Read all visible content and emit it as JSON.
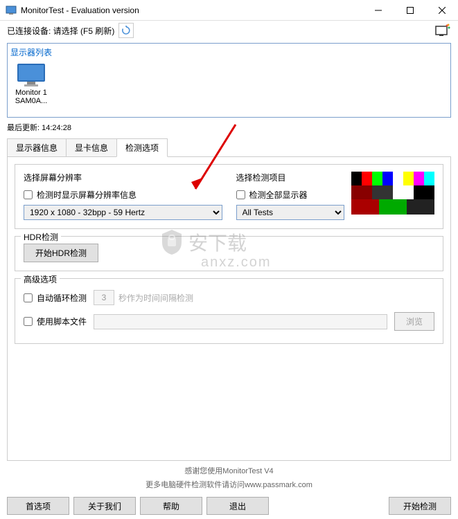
{
  "titlebar": {
    "title": "MonitorTest - Evaluation version"
  },
  "toolbar": {
    "connected_label": "已连接设备: 请选择 (F5 刷新)"
  },
  "monitor_list": {
    "title": "显示器列表",
    "items": [
      {
        "line1": "Monitor 1",
        "line2": "SAM0A..."
      }
    ]
  },
  "last_update": {
    "label": "最后更新:",
    "time": "14:24:28"
  },
  "tabs": [
    {
      "label": "显示器信息"
    },
    {
      "label": "显卡信息"
    },
    {
      "label": "检测选项"
    }
  ],
  "detect_panel": {
    "resolution_legend": "选择屏幕分辨率",
    "show_info_checkbox": "检测时显示屏幕分辨率信息",
    "resolution_select": "1920 x 1080 - 32bpp - 59 Hertz",
    "test_item_legend": "选择检测项目",
    "all_monitors_checkbox": "检测全部显示器",
    "test_select": "All Tests",
    "hdr_legend": "HDR检测",
    "hdr_button": "开始HDR检测",
    "advanced_legend": "高级选项",
    "auto_loop_checkbox": "自动循环检测",
    "auto_loop_value": "3",
    "auto_loop_hint": "秒作为时间间隔检测",
    "script_checkbox": "使用脚本文件",
    "browse_button": "浏览"
  },
  "footer": {
    "line1": "感谢您使用MonitorTest V4",
    "line2": "更多电脑硬件检测软件请访问www.passmark.com"
  },
  "buttons": {
    "prefs": "首选项",
    "about": "关于我们",
    "help": "帮助",
    "exit": "退出",
    "start": "开始检测"
  },
  "watermark": {
    "main": "安下载",
    "sub": "anxz.com"
  }
}
